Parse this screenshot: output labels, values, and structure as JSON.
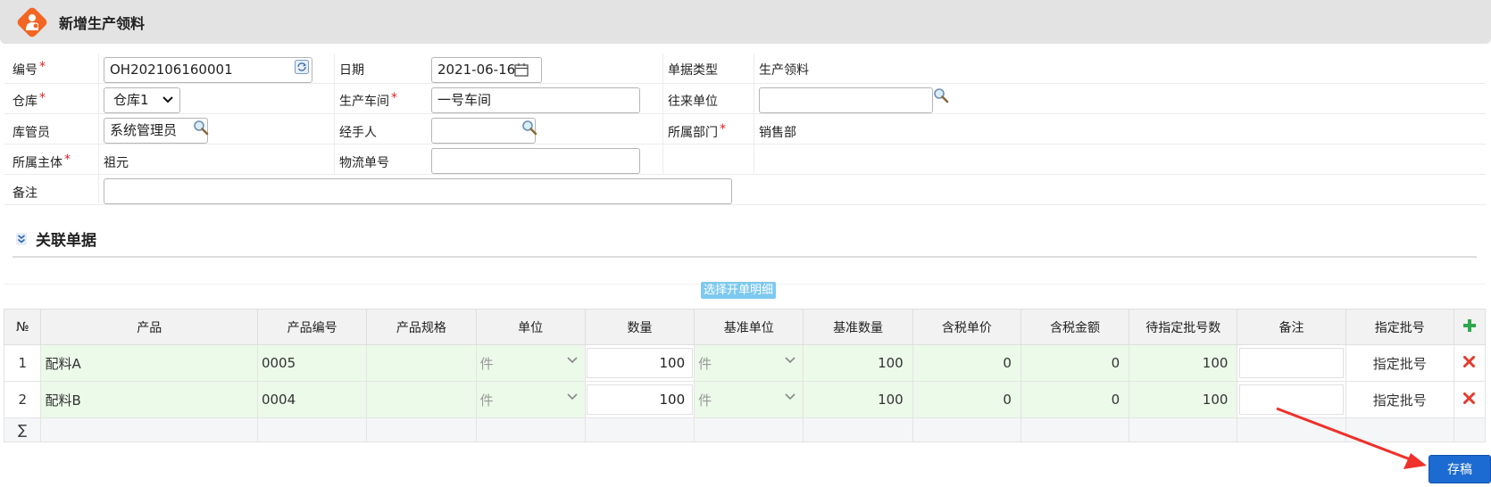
{
  "header": {
    "title": "新增生产领料"
  },
  "form": {
    "code_label": "编号",
    "code_value": "OH202106160001",
    "date_label": "日期",
    "date_value": "2021-06-16",
    "doctype_label": "单据类型",
    "doctype_value": "生产领料",
    "warehouse_label": "仓库",
    "warehouse_value": "仓库1",
    "workshop_label": "生产车间",
    "workshop_value": "一号车间",
    "partner_label": "往来单位",
    "partner_value": "",
    "keeper_label": "库管员",
    "keeper_value": "系统管理员",
    "handler_label": "经手人",
    "handler_value": "",
    "dept_label": "所属部门",
    "dept_value": "销售部",
    "entity_label": "所属主体",
    "entity_value": "祖元",
    "logistics_label": "物流单号",
    "logistics_value": "",
    "remark_label": "备注",
    "remark_value": "",
    "required_mark": "*"
  },
  "related": {
    "title": "关联单据",
    "pick_button": "选择开单明细"
  },
  "table": {
    "headers": [
      "№",
      "产品",
      "产品编号",
      "产品规格",
      "单位",
      "数量",
      "基准单位",
      "基准数量",
      "含税单价",
      "含税金额",
      "待指定批号数",
      "备注",
      "指定批号"
    ],
    "rows": [
      {
        "no": "1",
        "product": "配料A",
        "code": "0005",
        "spec": "",
        "unit": "件",
        "qty": "100",
        "base_unit": "件",
        "base_qty": "100",
        "price": "0",
        "amount": "0",
        "pending": "100",
        "memo": "",
        "batch_link": "指定批号"
      },
      {
        "no": "2",
        "product": "配料B",
        "code": "0004",
        "spec": "",
        "unit": "件",
        "qty": "100",
        "base_unit": "件",
        "base_qty": "100",
        "price": "0",
        "amount": "0",
        "pending": "100",
        "memo": "",
        "batch_link": "指定批号"
      }
    ],
    "sum_symbol": "∑"
  },
  "actions": {
    "save_label": "存稿"
  },
  "colors": {
    "accent": "#1c6bd3",
    "logo": "#f26522",
    "arrow": "#f0302a",
    "highlight": "#ecfae9"
  },
  "icons": [
    "user-logo-icon",
    "refresh-icon",
    "calendar-icon",
    "search-icon",
    "chevron-down-icon",
    "expand-icon",
    "add-icon",
    "delete-icon"
  ]
}
